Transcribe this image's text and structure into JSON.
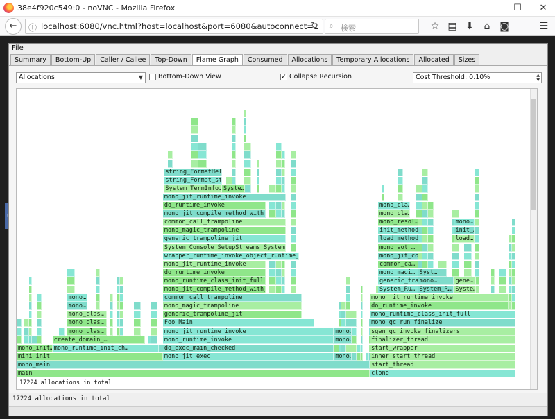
{
  "window": {
    "title": "38e4f920c549:0 - noVNC - Mozilla Firefox",
    "minimize_glyph": "—",
    "maximize_glyph": "☐",
    "close_glyph": "✕"
  },
  "navbar": {
    "back_glyph": "←",
    "info_glyph": "ⓘ",
    "url": "localhost:6080/vnc.html?host=localhost&port=6080&autoconnect=1",
    "reload_glyph": "↻",
    "search_placeholder": "検索",
    "search_glyph": "⌕",
    "icons": [
      "star-icon",
      "reader-icon",
      "download-icon",
      "home-icon",
      "pocket-icon",
      "menu-icon"
    ],
    "icon_glyphs": [
      "☆",
      "▤",
      "⬇",
      "⌂",
      "◙",
      "☰"
    ]
  },
  "vnc": {
    "handle_glyph": "▸"
  },
  "app": {
    "menu_file": "File",
    "tabs": [
      "Summary",
      "Bottom-Up",
      "Caller / Callee",
      "Top-Down",
      "Flame Graph",
      "Consumed",
      "Allocations",
      "Temporary Allocations",
      "Allocated",
      "Sizes"
    ],
    "active_tab": "Flame Graph",
    "controls": {
      "cost_type": "Allocations",
      "bottom_down_label": "Bottom-Down View",
      "bottom_down_checked": false,
      "collapse_label": "Collapse Recursion",
      "collapse_checked": true,
      "threshold_text": "Cost Threshold: 0.10%"
    },
    "graph_status": "17224 allocations in total",
    "status_text": "17224 allocations in total"
  },
  "colors": {
    "frame_green": "#8fe68a",
    "frame_cyan": "#86e6d4",
    "frame_teal": "#7fdccb",
    "frame_light": "#a8eea2"
  },
  "flame": {
    "blocks": [
      {
        "name": "main",
        "depth": 0,
        "start": 0.0,
        "width": 0.688
      },
      {
        "name": "clone",
        "depth": 0,
        "start": 0.688,
        "width": 0.283
      },
      {
        "name": "mono_main",
        "depth": 1,
        "start": 0.0,
        "width": 0.688
      },
      {
        "name": "start_thread",
        "depth": 1,
        "start": 0.688,
        "width": 0.283
      },
      {
        "name": "mini_init",
        "depth": 2,
        "start": 0.0,
        "width": 0.285
      },
      {
        "name": "mono_jit_exec",
        "depth": 2,
        "start": 0.285,
        "width": 0.333
      },
      {
        "name": "mono…",
        "depth": 2,
        "start": 0.618,
        "width": 0.035
      },
      {
        "name": "inner_start_thread",
        "depth": 2,
        "start": 0.688,
        "width": 0.283
      },
      {
        "name": "mono_init…",
        "depth": 3,
        "start": 0.0,
        "width": 0.07
      },
      {
        "name": "mono_runtime_init_ch…",
        "depth": 3,
        "start": 0.07,
        "width": 0.207
      },
      {
        "name": "do_exec_main_checked",
        "depth": 3,
        "start": 0.285,
        "width": 0.333
      },
      {
        "name": "start_wrapper",
        "depth": 3,
        "start": 0.688,
        "width": 0.283
      },
      {
        "name": "create_domain_…",
        "depth": 4,
        "start": 0.07,
        "width": 0.18
      },
      {
        "name": "mono_runtime_invoke",
        "depth": 4,
        "start": 0.285,
        "width": 0.333
      },
      {
        "name": "mono…",
        "depth": 4,
        "start": 0.618,
        "width": 0.035
      },
      {
        "name": "finalizer_thread",
        "depth": 4,
        "start": 0.688,
        "width": 0.283
      },
      {
        "name": "mono_clas…",
        "depth": 5,
        "start": 0.098,
        "width": 0.078
      },
      {
        "name": "mono_jit_runtime_invoke",
        "depth": 5,
        "start": 0.285,
        "width": 0.333
      },
      {
        "name": "mono…",
        "depth": 5,
        "start": 0.618,
        "width": 0.035
      },
      {
        "name": "sgen_gc_invoke_finalizers",
        "depth": 5,
        "start": 0.688,
        "width": 0.283
      },
      {
        "name": "mono_clas…",
        "depth": 6,
        "start": 0.098,
        "width": 0.078
      },
      {
        "name": "Foo_Main",
        "depth": 6,
        "start": 0.285,
        "width": 0.295
      },
      {
        "name": "mono_gc_run_finalize",
        "depth": 6,
        "start": 0.688,
        "width": 0.283
      },
      {
        "name": "mono_clas…",
        "depth": 7,
        "start": 0.098,
        "width": 0.078
      },
      {
        "name": "generic_trampoline_jit",
        "depth": 7,
        "start": 0.285,
        "width": 0.27
      },
      {
        "name": "mono_runtime_class_init_full",
        "depth": 7,
        "start": 0.688,
        "width": 0.283
      },
      {
        "name": "mono…",
        "depth": 8,
        "start": 0.098,
        "width": 0.04
      },
      {
        "name": "mono_magic_trampoline",
        "depth": 8,
        "start": 0.285,
        "width": 0.27
      },
      {
        "name": "do_runtime_invoke",
        "depth": 8,
        "start": 0.688,
        "width": 0.27
      },
      {
        "name": "mono…",
        "depth": 9,
        "start": 0.098,
        "width": 0.04
      },
      {
        "name": "common_call_trampoline",
        "depth": 9,
        "start": 0.285,
        "width": 0.27
      },
      {
        "name": "mono_jit_runtime_invoke",
        "depth": 9,
        "start": 0.688,
        "width": 0.27
      },
      {
        "name": "mono_jit_compile_method_with_opt",
        "depth": 10,
        "start": 0.285,
        "width": 0.2
      },
      {
        "name": "System_Ru…",
        "depth": 10,
        "start": 0.704,
        "width": 0.078
      },
      {
        "name": "System_R…",
        "depth": 10,
        "start": 0.782,
        "width": 0.07
      },
      {
        "name": "Syste…",
        "depth": 10,
        "start": 0.852,
        "width": 0.043
      },
      {
        "name": "mono_runtime_class_init_full",
        "depth": 11,
        "start": 0.285,
        "width": 0.2
      },
      {
        "name": "generic_tra…",
        "depth": 11,
        "start": 0.704,
        "width": 0.078
      },
      {
        "name": "mono…",
        "depth": 11,
        "start": 0.782,
        "width": 0.07
      },
      {
        "name": "gene…",
        "depth": 11,
        "start": 0.852,
        "width": 0.043
      },
      {
        "name": "do_runtime_invoke",
        "depth": 12,
        "start": 0.285,
        "width": 0.2
      },
      {
        "name": "mono_magi…",
        "depth": 12,
        "start": 0.704,
        "width": 0.078
      },
      {
        "name": "Syst…",
        "depth": 12,
        "start": 0.782,
        "width": 0.04
      },
      {
        "name": "mono_jit_runtime_invoke",
        "depth": 13,
        "start": 0.285,
        "width": 0.2
      },
      {
        "name": "common_ca…",
        "depth": 13,
        "start": 0.704,
        "width": 0.078
      },
      {
        "name": "wrapper_runtime_invoke_object_runtime_invok",
        "depth": 14,
        "start": 0.285,
        "width": 0.265
      },
      {
        "name": "mono_jit_co…",
        "depth": 14,
        "start": 0.704,
        "width": 0.078
      },
      {
        "name": "System_Console_SetupStreams_System_Te…",
        "depth": 15,
        "start": 0.285,
        "width": 0.24
      },
      {
        "name": "mono_aot_…",
        "depth": 15,
        "start": 0.704,
        "width": 0.078
      },
      {
        "name": "generic_trampoline_jit",
        "depth": 16,
        "start": 0.285,
        "width": 0.24
      },
      {
        "name": "load_method",
        "depth": 16,
        "start": 0.704,
        "width": 0.078
      },
      {
        "name": "load…",
        "depth": 16,
        "start": 0.852,
        "width": 0.04
      },
      {
        "name": "mono_magic_trampoline",
        "depth": 17,
        "start": 0.285,
        "width": 0.24
      },
      {
        "name": "init_method",
        "depth": 17,
        "start": 0.704,
        "width": 0.078
      },
      {
        "name": "init_…",
        "depth": 17,
        "start": 0.852,
        "width": 0.04
      },
      {
        "name": "common_call_trampoline",
        "depth": 18,
        "start": 0.285,
        "width": 0.24
      },
      {
        "name": "mono_resol…",
        "depth": 18,
        "start": 0.704,
        "width": 0.078
      },
      {
        "name": "mono…",
        "depth": 18,
        "start": 0.852,
        "width": 0.04
      },
      {
        "name": "mono_jit_compile_method_with_opt",
        "depth": 19,
        "start": 0.285,
        "width": 0.2
      },
      {
        "name": "mono_cla…",
        "depth": 19,
        "start": 0.704,
        "width": 0.062
      },
      {
        "name": "do_runtime_invoke",
        "depth": 20,
        "start": 0.285,
        "width": 0.2
      },
      {
        "name": "mono_cla…",
        "depth": 20,
        "start": 0.704,
        "width": 0.062
      },
      {
        "name": "mono_jit_runtime_invoke",
        "depth": 21,
        "start": 0.285,
        "width": 0.24
      },
      {
        "name": "System_TermInfo…",
        "depth": 22,
        "start": 0.287,
        "width": 0.113
      },
      {
        "name": "Syste…",
        "depth": 22,
        "start": 0.4,
        "width": 0.045
      },
      {
        "name": "string_Format_str",
        "depth": 23,
        "start": 0.287,
        "width": 0.113
      },
      {
        "name": "string_FormatHel…",
        "depth": 24,
        "start": 0.287,
        "width": 0.113
      }
    ]
  }
}
